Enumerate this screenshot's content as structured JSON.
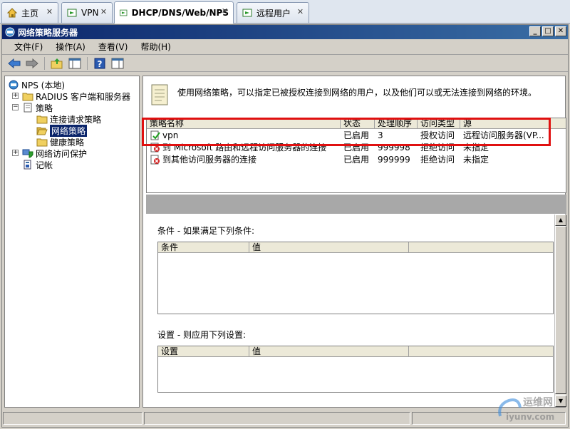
{
  "tabs": [
    {
      "label": "主页",
      "icon": "home-icon"
    },
    {
      "label": "VPN",
      "icon": "vm-icon"
    },
    {
      "label": "DHCP/DNS/Web/NPS",
      "icon": "vm-icon",
      "active": true
    },
    {
      "label": "远程用户",
      "icon": "vm-icon"
    }
  ],
  "window": {
    "title": "网络策略服务器"
  },
  "menu": [
    "文件(F)",
    "操作(A)",
    "查看(V)",
    "帮助(H)"
  ],
  "tree": {
    "root": "NPS (本地)",
    "radius": "RADIUS 客户端和服务器",
    "policies": "策略",
    "conn_request": "连接请求策略",
    "network_policies": "网络策略",
    "health_policies": "健康策略",
    "nap": "网络访问保护",
    "accounting": "记帐"
  },
  "description": "使用网络策略，可以指定已被授权连接到网络的用户，以及他们可以或无法连接到网络的环境。",
  "policy_table": {
    "columns": [
      "策略名称",
      "状态",
      "处理顺序",
      "访问类型",
      "源"
    ],
    "rows": [
      {
        "name": "vpn",
        "status": "已启用",
        "order": "3",
        "access": "授权访问",
        "source": "远程访问服务器(VP..."
      },
      {
        "name": "到 Microsoft 路由和远程访问服务器的连接",
        "status": "已启用",
        "order": "999998",
        "access": "拒绝访问",
        "source": "未指定"
      },
      {
        "name": "到其他访问服务器的连接",
        "status": "已启用",
        "order": "999999",
        "access": "拒绝访问",
        "source": "未指定"
      }
    ]
  },
  "conditions": {
    "label": "条件 - 如果满足下列条件:",
    "columns": [
      "条件",
      "值"
    ]
  },
  "settings": {
    "label": "设置 - 则应用下列设置:",
    "columns": [
      "设置",
      "值"
    ]
  },
  "watermark": {
    "line1": "运维网",
    "line2": "iyunv.com"
  },
  "colors": {
    "titlebar": "#0a246a",
    "highlight": "#e01010",
    "selection": "#0a246a"
  }
}
